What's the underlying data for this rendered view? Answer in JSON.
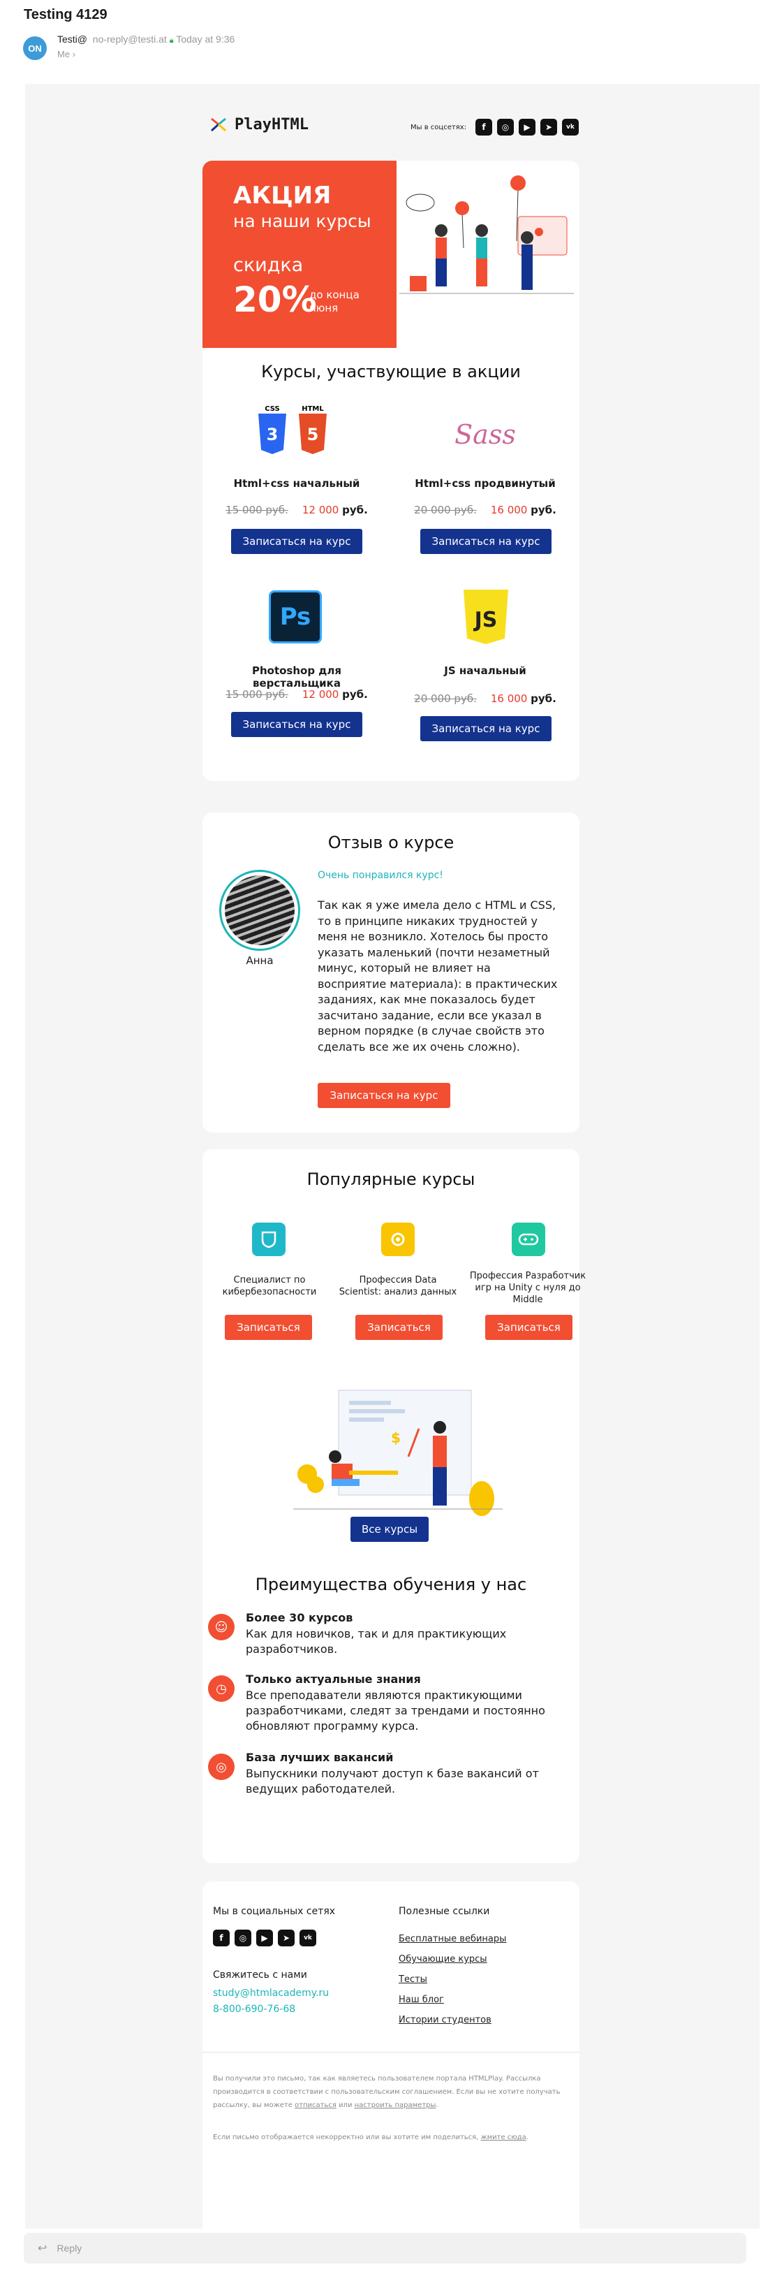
{
  "email": {
    "subject": "Testing 4129",
    "avatar": "ON",
    "sender_name": "Testi@",
    "sender_addr": "no-reply@testi.at",
    "time": "Today at 9:36",
    "recipient": "Me"
  },
  "header": {
    "logo_text": "PlayHTML",
    "social_label": "Мы в соцсетях:",
    "social_icons": [
      "facebook-icon",
      "instagram-icon",
      "youtube-icon",
      "telegram-icon",
      "vk-icon"
    ]
  },
  "promo": {
    "line1": "АКЦИЯ",
    "line2": "на наши курсы",
    "line3": "скидка",
    "percent": "20%",
    "note": "до конца июня"
  },
  "courses": {
    "title": "Курсы, участвующие в акции",
    "items": [
      {
        "name": "Html+css начальный",
        "old": "15 000 руб.",
        "new": "12 000",
        "cur": "руб.",
        "button": "Записаться на курс"
      },
      {
        "name": "Html+css продвинутый",
        "old": "20 000 руб.",
        "new": "16 000",
        "cur": "руб.",
        "button": "Записаться на курс"
      },
      {
        "name": "Photoshop для верстальщика",
        "old": "15 000 руб.",
        "new": "12 000",
        "cur": "руб.",
        "button": "Записаться на курс"
      },
      {
        "name": "JS начальный",
        "old": "20 000 руб.",
        "new": "16 000",
        "cur": "руб.",
        "button": "Записаться на курс"
      }
    ],
    "icon_text": {
      "css": "CSS",
      "html": "HTML",
      "sass": "Sass",
      "ps": "Ps",
      "js": "JS"
    }
  },
  "review": {
    "title": "Отзыв о курсе",
    "author": "Анна",
    "headline": "Очень понравился курс!",
    "text": "Так как я уже имела дело с HTML и CSS, то в принципе никаких трудностей у меня не возникло. Хотелось бы просто указать маленький (почти незаметный минус, который не влияет на восприятие материала): в практических заданиях, как мне показалось будет засчитано задание, если все указал в верном порядке (в случае свойств это сделать все же их очень сложно).",
    "button": "Записаться на курс"
  },
  "popular": {
    "title": "Популярные курсы",
    "items": [
      {
        "name": "Специалист по кибербезопасности",
        "button": "Записаться"
      },
      {
        "name": "Профессия Data Scientist: анализ данных",
        "button": "Записаться"
      },
      {
        "name": "Профессия Разработчик игр на Unity с нуля до Middle",
        "button": "Записаться"
      }
    ],
    "all_button": "Все курсы"
  },
  "advantages": {
    "title": "Преимущества обучения у нас",
    "items": [
      {
        "title": "Более 30 курсов",
        "text": "Как для новичков, так и для практикующих разработчиков."
      },
      {
        "title": "Только актуальные знания",
        "text": "Все преподаватели являются практикующими разработчиками, следят за трендами и постоянно обновляют программу курса."
      },
      {
        "title": "База лучших вакансий",
        "text": "Выпускники получают доступ к базе вакансий от ведущих работодателей."
      }
    ]
  },
  "footer": {
    "social_title": "Мы в социальных сетях",
    "contact_title": "Свяжитесь с нами",
    "email": "study@htmlacademy.ru",
    "phone": "8-800-690-76-68",
    "links_title": "Полезные ссылки",
    "links": [
      "Бесплатные вебинары",
      "Обучающие курсы",
      "Тесты",
      "Наш блог",
      "Истории студентов"
    ],
    "disclaimer_1": "Вы получили это письмо, так как являетесь пользователем портала HTMLPlay. Рассылка производится в соответствии с пользовательским соглашением. Если вы не хотите получать рассылку, вы можете",
    "unsubscribe": "отписаться",
    "or": "или",
    "settings": "настроить параметры",
    "disclaimer_2": "Если письмо отображается некорректно или вы хотите им поделиться,",
    "view_link": "жмите сюда"
  },
  "reply": {
    "label": "Reply"
  },
  "colors": {
    "accent": "#f24e32",
    "blue": "#13338f",
    "teal": "#1db5b8"
  }
}
